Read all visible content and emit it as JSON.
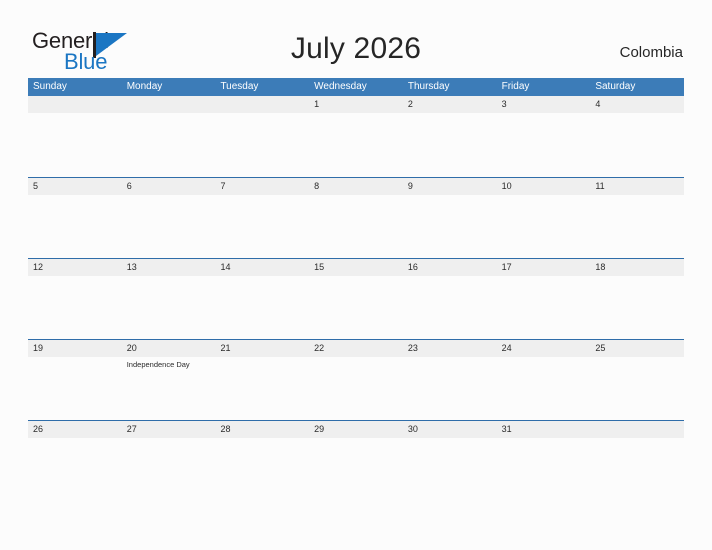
{
  "brand": {
    "name_part1": "General",
    "name_part2": "Blue",
    "flag_icon": "flag-icon",
    "accent_color": "#1b76c3"
  },
  "header": {
    "title": "July 2026",
    "country": "Colombia"
  },
  "theme": {
    "header_blue": "#3c7cb8",
    "row_line_blue": "#2f6da9",
    "band_gray": "#efefef",
    "page_background": "#fcfcfc",
    "text_color": "#2b2b2b"
  },
  "calendar": {
    "month": "July",
    "year": "2026",
    "weekdays": [
      "Sunday",
      "Monday",
      "Tuesday",
      "Wednesday",
      "Thursday",
      "Friday",
      "Saturday"
    ],
    "weeks": [
      [
        {
          "day": "",
          "events": []
        },
        {
          "day": "",
          "events": []
        },
        {
          "day": "",
          "events": []
        },
        {
          "day": "1",
          "events": []
        },
        {
          "day": "2",
          "events": []
        },
        {
          "day": "3",
          "events": []
        },
        {
          "day": "4",
          "events": []
        }
      ],
      [
        {
          "day": "5",
          "events": []
        },
        {
          "day": "6",
          "events": []
        },
        {
          "day": "7",
          "events": []
        },
        {
          "day": "8",
          "events": []
        },
        {
          "day": "9",
          "events": []
        },
        {
          "day": "10",
          "events": []
        },
        {
          "day": "11",
          "events": []
        }
      ],
      [
        {
          "day": "12",
          "events": []
        },
        {
          "day": "13",
          "events": []
        },
        {
          "day": "14",
          "events": []
        },
        {
          "day": "15",
          "events": []
        },
        {
          "day": "16",
          "events": []
        },
        {
          "day": "17",
          "events": []
        },
        {
          "day": "18",
          "events": []
        }
      ],
      [
        {
          "day": "19",
          "events": []
        },
        {
          "day": "20",
          "events": [
            "Independence Day"
          ]
        },
        {
          "day": "21",
          "events": []
        },
        {
          "day": "22",
          "events": []
        },
        {
          "day": "23",
          "events": []
        },
        {
          "day": "24",
          "events": []
        },
        {
          "day": "25",
          "events": []
        }
      ],
      [
        {
          "day": "26",
          "events": []
        },
        {
          "day": "27",
          "events": []
        },
        {
          "day": "28",
          "events": []
        },
        {
          "day": "29",
          "events": []
        },
        {
          "day": "30",
          "events": []
        },
        {
          "day": "31",
          "events": []
        },
        {
          "day": "",
          "events": []
        }
      ]
    ]
  }
}
